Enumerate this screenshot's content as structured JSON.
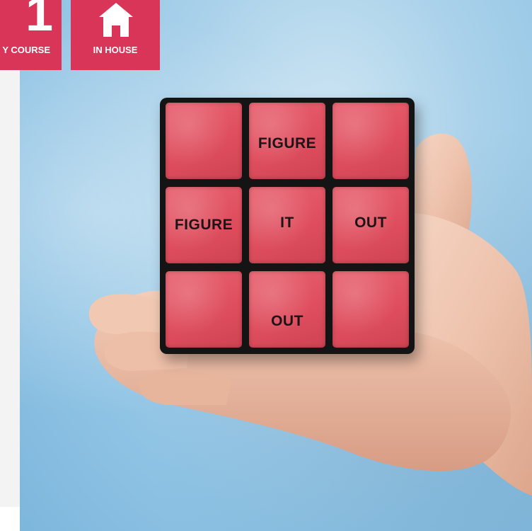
{
  "badges": [
    {
      "number": "1",
      "label": "Y COURSE",
      "icon": "number-one"
    },
    {
      "label": "IN HOUSE",
      "icon": "house-icon"
    }
  ],
  "hero": {
    "image_description_icon": "rubiks-cube-in-hand",
    "cube_tiles": [
      "",
      "FIGURE",
      "",
      "FIGURE",
      "IT",
      "OUT",
      "",
      "OUT",
      ""
    ]
  },
  "colors": {
    "badge": "#d93558",
    "tile": "#df4e5e",
    "background": "#8fc3e4"
  }
}
